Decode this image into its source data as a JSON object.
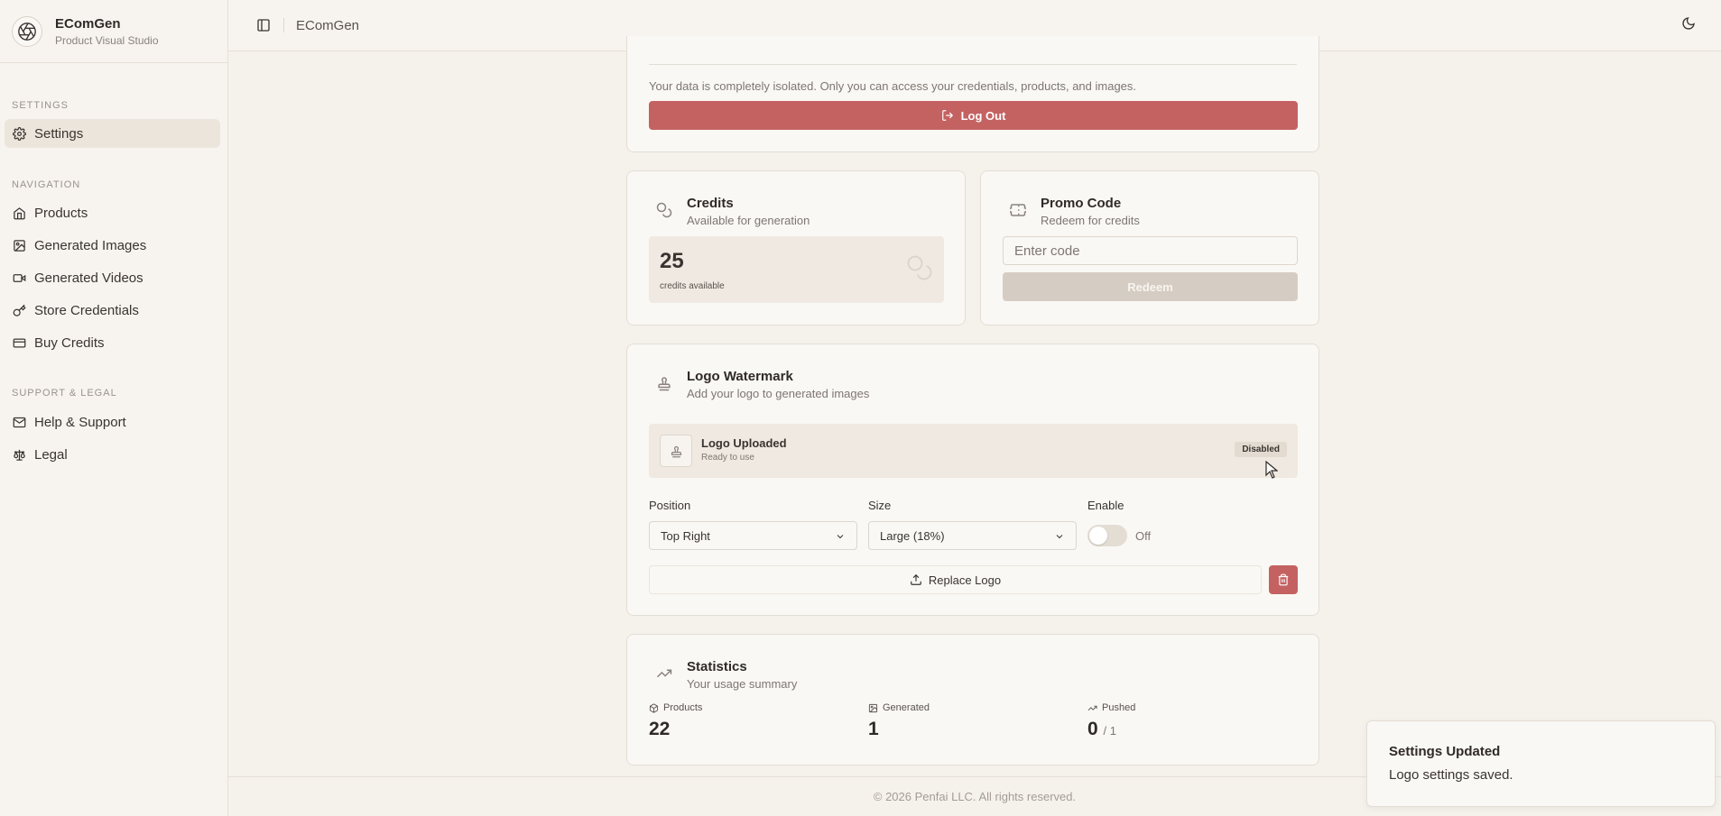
{
  "brand": {
    "name": "EComGen",
    "subtitle": "Product Visual Studio"
  },
  "sidebar": {
    "sections": [
      {
        "label": "SETTINGS"
      },
      {
        "label": "NAVIGATION"
      },
      {
        "label": "SUPPORT & LEGAL"
      }
    ],
    "items": [
      {
        "label": "Settings",
        "icon": "gear-icon",
        "active": true
      },
      {
        "label": "Products",
        "icon": "home-icon"
      },
      {
        "label": "Generated Images",
        "icon": "image-icon"
      },
      {
        "label": "Generated Videos",
        "icon": "video-icon"
      },
      {
        "label": "Store Credentials",
        "icon": "key-icon"
      },
      {
        "label": "Buy Credits",
        "icon": "credit-card-icon"
      },
      {
        "label": "Help & Support",
        "icon": "mail-icon"
      },
      {
        "label": "Legal",
        "icon": "scale-icon"
      }
    ]
  },
  "topbar": {
    "title": "EComGen"
  },
  "account": {
    "note": "Your data is completely isolated. Only you can access your credentials, products, and images.",
    "logout_label": "Log Out"
  },
  "credits": {
    "title": "Credits",
    "subtitle": "Available for generation",
    "value": "25",
    "caption": "credits available"
  },
  "promo": {
    "title": "Promo Code",
    "subtitle": "Redeem for credits",
    "placeholder": "Enter code",
    "button": "Redeem"
  },
  "watermark": {
    "title": "Logo Watermark",
    "subtitle": "Add your logo to generated images",
    "status_title": "Logo Uploaded",
    "status_sub": "Ready to use",
    "badge": "Disabled",
    "position_label": "Position",
    "position_value": "Top Right",
    "size_label": "Size",
    "size_value": "Large (18%)",
    "enable_label": "Enable",
    "enable_state": "Off",
    "replace_label": "Replace Logo"
  },
  "stats": {
    "title": "Statistics",
    "subtitle": "Your usage summary",
    "products_label": "Products",
    "products_value": "22",
    "generated_label": "Generated",
    "generated_value": "1",
    "pushed_label": "Pushed",
    "pushed_value": "0",
    "pushed_total": "/ 1"
  },
  "footer": "© 2026 Penfai LLC. All rights reserved.",
  "toast": {
    "title": "Settings Updated",
    "message": "Logo settings saved."
  },
  "colors": {
    "accent_red": "#c46262",
    "background": "#f5f2ec",
    "card": "#faf8f4"
  }
}
